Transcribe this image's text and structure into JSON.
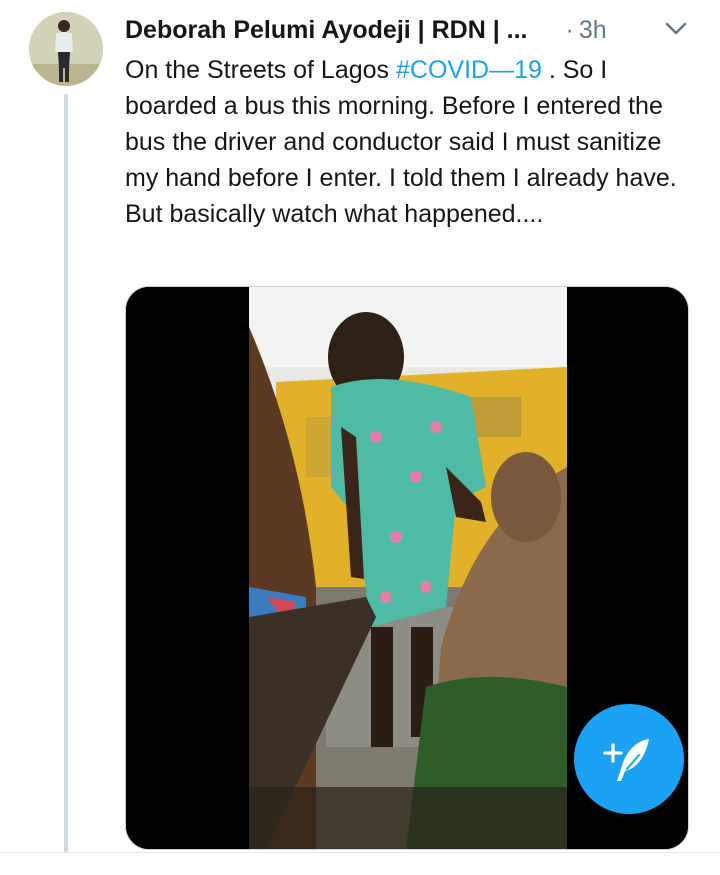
{
  "tweet": {
    "author_name": "Deborah Pelumi Ayodeji | RDN | ...",
    "separator": "·",
    "time_ago": "3h",
    "text_before": "On the Streets of Lagos ",
    "hashtag": "#COVID—19",
    "text_after": " . So I boarded a bus this morning. Before I entered the bus the driver and conductor said I must sanitize my hand before I enter. I told them I already have. But basically watch what happened....",
    "media_type": "video"
  },
  "icons": {
    "more": "chevron-down-icon",
    "compose": "feather-plus-icon"
  },
  "colors": {
    "accent": "#1da1f2",
    "muted": "#657786",
    "text": "#14171a",
    "thread_line": "#cfd9de"
  }
}
